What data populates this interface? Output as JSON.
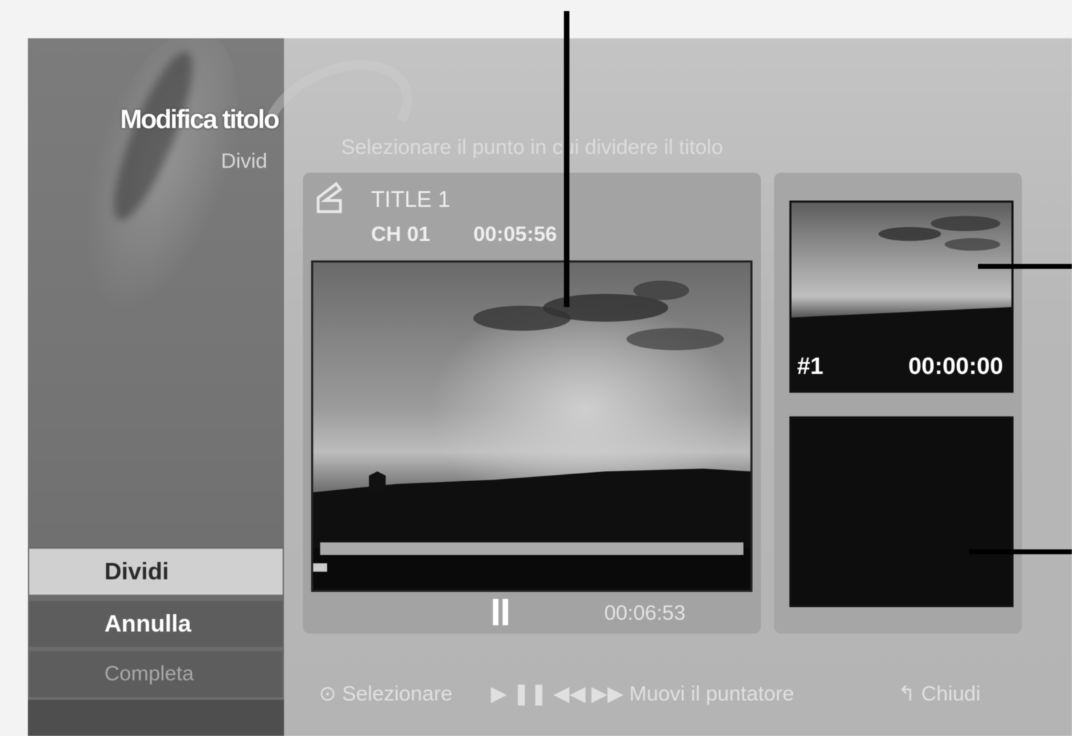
{
  "sidebar": {
    "menu_title": "Modifica titolo",
    "menu_subtitle": "Divid",
    "items": [
      {
        "label": "Dividi",
        "selected": true
      },
      {
        "label": "Annulla",
        "selected": false
      },
      {
        "label": "Completa",
        "selected": false
      }
    ]
  },
  "instruction": "Selezionare il punto in cui dividere il titolo",
  "main_preview": {
    "title": "TITLE 1",
    "chapter": "CH 01",
    "title_time": "00:05:56",
    "playback_state": "pause",
    "playback_time": "00:06:53"
  },
  "thumbnails": [
    {
      "number": "#1",
      "time": "00:00:00"
    },
    {
      "number": "",
      "time": ""
    }
  ],
  "help_bar": {
    "select": "⊙ Selezionare",
    "transport": "▶ ❚❚ ◀◀ ▶▶ Muovi il puntatore",
    "back": "↰ Chiudi"
  }
}
